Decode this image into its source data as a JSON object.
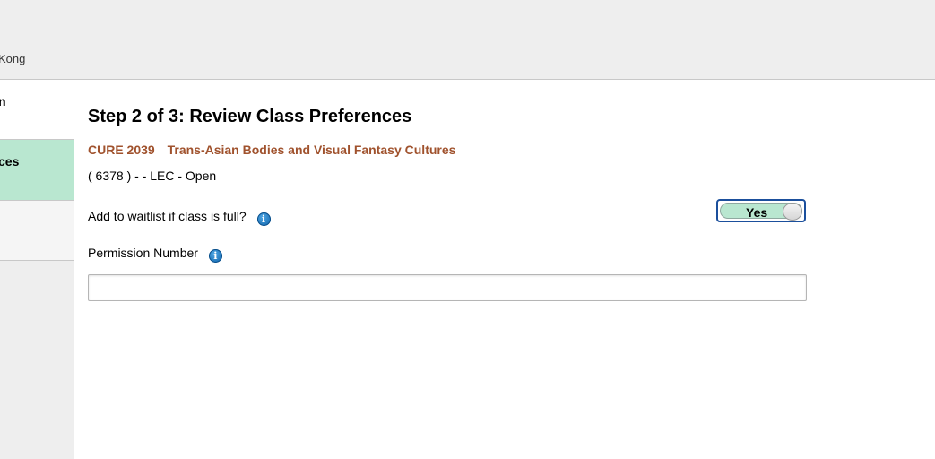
{
  "header": {
    "university_text_fragment": "Kong"
  },
  "sidebar": {
    "items": [
      {
        "label_fragment": "n"
      },
      {
        "label_fragment": "ces"
      },
      {
        "label_fragment": ""
      }
    ]
  },
  "main": {
    "title": "Step 2 of 3: Review Class Preferences",
    "course_code": "CURE 2039",
    "course_title": "Trans-Asian Bodies and Visual Fantasy Cultures",
    "section_info": "( 6378 ) - - LEC - Open",
    "waitlist_label": "Add to waitlist if class is full?",
    "waitlist_toggle_value": "Yes",
    "permission_label": "Permission Number",
    "permission_value": "",
    "info_icon_glyph": "i"
  },
  "colors": {
    "course_link": "#a0522d",
    "selected_step_bg": "#b9e7d0",
    "toggle_border": "#1b4f9c",
    "info_icon": "#0a5fa8"
  }
}
